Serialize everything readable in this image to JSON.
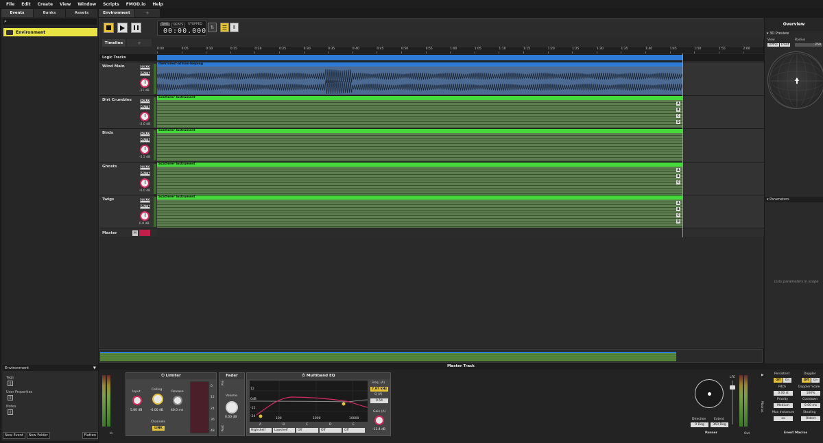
{
  "menu": [
    "File",
    "Edit",
    "Create",
    "View",
    "Window",
    "Scripts",
    "FMOD.io",
    "Help"
  ],
  "left_tabs": [
    "Events",
    "Banks",
    "Assets"
  ],
  "event_item": "Environment",
  "env_panel": {
    "title": "Environment",
    "tags": "Tags",
    "user_props": "User Properties",
    "notes": "Notes",
    "btn_new_event": "New Event",
    "btn_new_folder": "New Folder",
    "btn_flatten": "Flatten"
  },
  "doc_tab": "Environment",
  "transport": {
    "time_mode_a": "TIME",
    "time_mode_b": "BEATS",
    "state": "STOPPED",
    "time": "00:00.000"
  },
  "timeline_tab": "Timeline",
  "ruler_ticks": [
    "0:00",
    "0:05",
    "0:10",
    "0:15",
    "0:20",
    "0:25",
    "0:30",
    "0:35",
    "0:40",
    "0:45",
    "0:50",
    "0:55",
    "1:00",
    "1:05",
    "1:10",
    "1:15",
    "1:20",
    "1:25",
    "1:30",
    "1:35",
    "1:40",
    "1:45",
    "1:50",
    "1:55",
    "2:00"
  ],
  "logic_tracks": "Logic Tracks",
  "tracks": [
    {
      "name": "Wind Main",
      "db": "-11 dB",
      "block": "darkforest-atmos-looping",
      "kind": "wave",
      "letters": []
    },
    {
      "name": "Dirt Crumbles",
      "db": "-2.0 dB",
      "block": "Scatterer Instrument",
      "kind": "scatter",
      "letters": [
        "A",
        "B",
        "C",
        "D"
      ]
    },
    {
      "name": "Birds",
      "db": "-1.5 dB",
      "block": "Scatterer Instrument",
      "kind": "scatter",
      "letters": []
    },
    {
      "name": "Ghosts",
      "db": "-6.0 dB",
      "block": "Scatterer Instrument",
      "kind": "scatter",
      "letters": [
        "A",
        "B",
        "C"
      ]
    },
    {
      "name": "Twigs",
      "db": "0.0 dB",
      "block": "Scatterer Instrument",
      "kind": "scatter",
      "letters": [
        "A",
        "B",
        "C",
        "D"
      ]
    }
  ],
  "track_buttons": {
    "solo": "SOLO",
    "mute": "MUTE"
  },
  "master_row": {
    "name": "Master",
    "m": "M"
  },
  "overview": {
    "title": "Overview",
    "preview": "3D Preview",
    "view_label": "View",
    "radius_label": "Radius",
    "orthographic": "Ortho",
    "front": "Front",
    "radius_value": "250",
    "parameters": "Parameters",
    "parameters_hint": "Lists parameters in scope"
  },
  "mixer": {
    "title": "Master Track",
    "in_label": "In",
    "out_label": "Out",
    "limiter": {
      "title": "Limiter",
      "input": "Input",
      "input_val": "5.80 dB",
      "ceiling": "Ceiling",
      "ceiling_val": "-6.00 dB",
      "release": "Release",
      "release_val": "40.0 ms",
      "channels": "Channels",
      "link": "LINK",
      "scale": [
        "0",
        "12",
        "24",
        "36",
        "48"
      ]
    },
    "fader": {
      "title": "Fader",
      "volume": "Volume",
      "volume_val": "0.00 dB",
      "pre": "Pre",
      "post": "Post"
    },
    "eq": {
      "title": "Multiband EQ",
      "freq": "Freq. (A)",
      "freq_val": "7.97 kHz",
      "q": "Q (A)",
      "q_val": "0.54",
      "gain": "Gain (A)",
      "gain_val": "-11.4 dB",
      "bands": [
        "A",
        "B",
        "C",
        "D",
        "E"
      ],
      "band_modes": [
        "Highshelf",
        "Lowshelf",
        "Off",
        "Off",
        "Off"
      ],
      "freq_ticks": [
        "100",
        "1000",
        "10000"
      ],
      "db_ticks": [
        "12",
        "0dB",
        "-12",
        "-24"
      ]
    },
    "panner": {
      "title": "Panner",
      "direction": "Direction",
      "direction_val": "0 Deg",
      "extent": "Extent",
      "extent_val": "360 Deg",
      "lfe": "LFE"
    },
    "macros": {
      "title": "Event Macros",
      "vertical": "Macros",
      "persistent": "Persistent",
      "persistent_off": "Off",
      "persistent_on": "On",
      "doppler": "Doppler",
      "doppler_off": "Off",
      "doppler_on": "On",
      "pitch": "Pitch",
      "pitch_val": "0.00 st",
      "doppler_scale": "Doppler Scale",
      "doppler_scale_val": "100%",
      "priority": "Priority",
      "priority_val": "Medium",
      "cooldown": "Cooldown",
      "cooldown_val": "0.00 ms",
      "max_instances": "Max Instances",
      "max_instances_val": "oo",
      "stealing": "Stealing",
      "stealing_val": "Oldest"
    }
  },
  "colors": {
    "accent": "#e9e444",
    "logic_blue": "#2d7bd6",
    "scatter_green": "#45d93a",
    "knob_pink": "#d12a5e"
  }
}
